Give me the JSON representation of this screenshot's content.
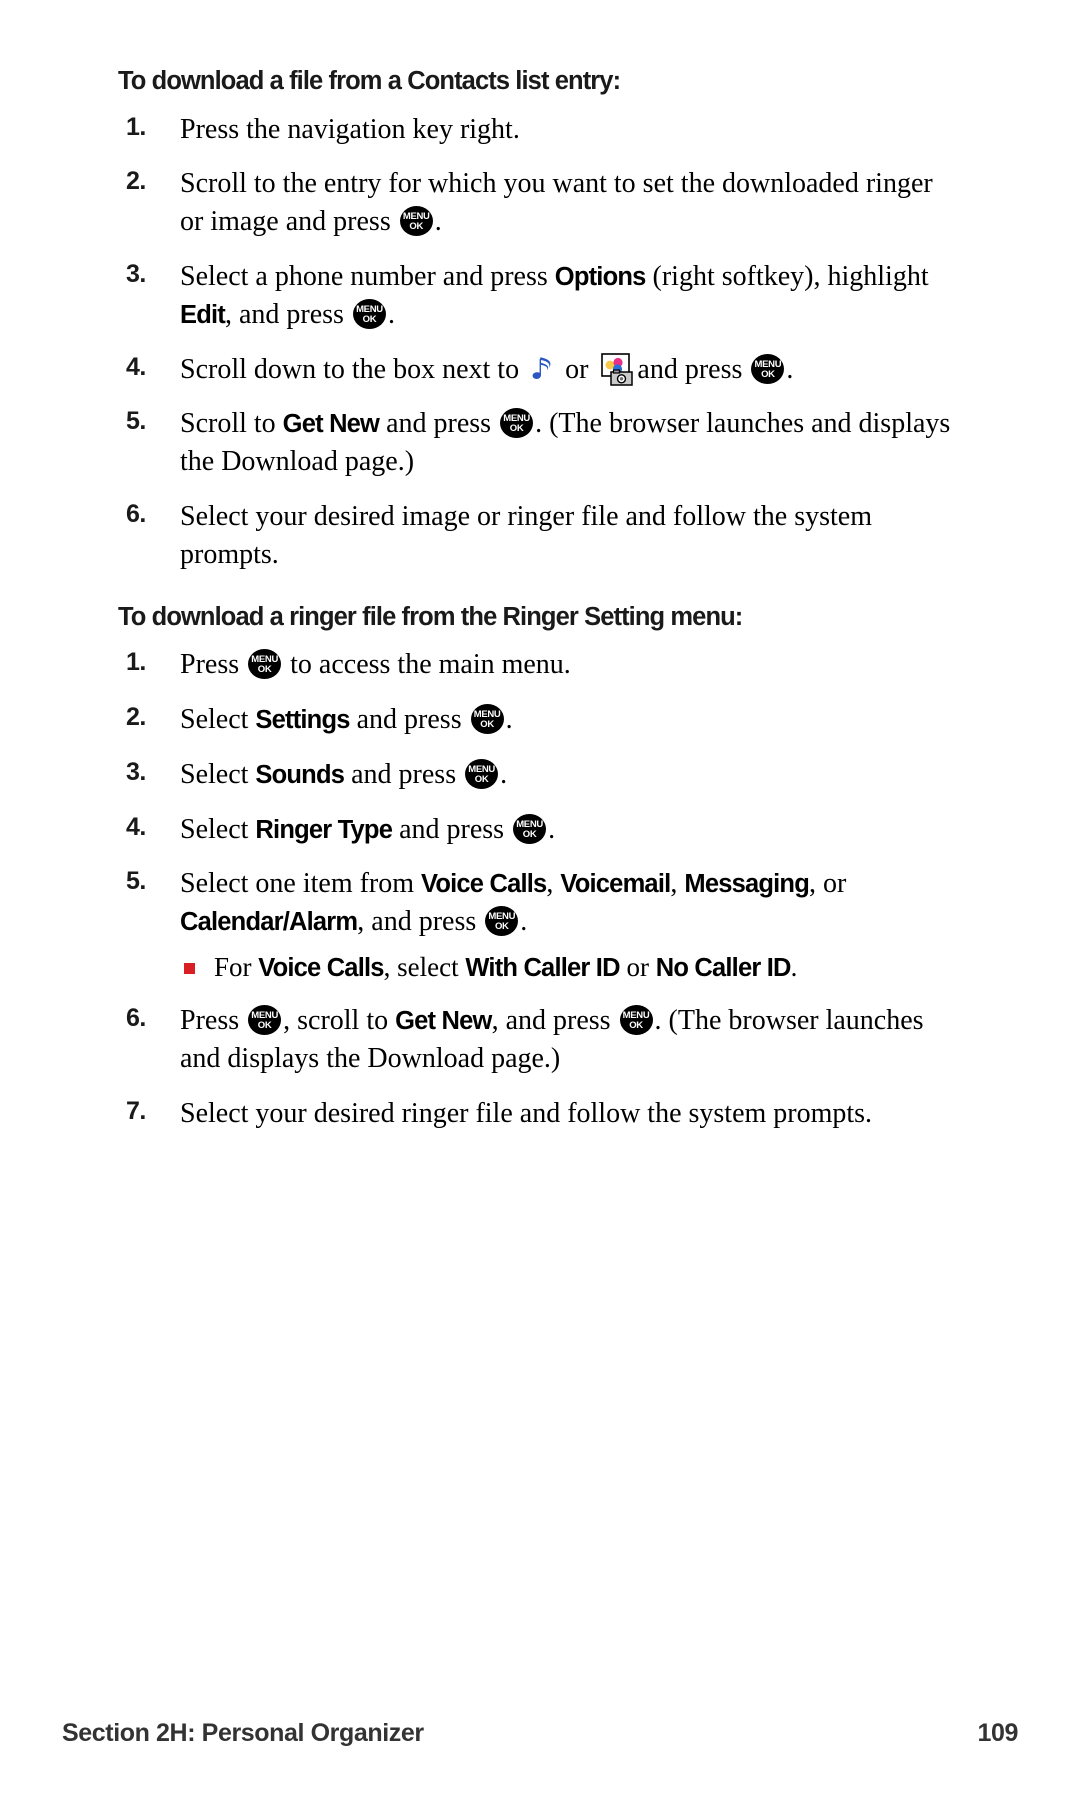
{
  "page": {
    "section_1": {
      "heading": "To download a file from a Contacts list entry:",
      "steps": [
        {
          "number": "1.",
          "parts": [
            {
              "t": "text",
              "v": "Press the navigation key right."
            }
          ]
        },
        {
          "number": "2.",
          "parts": [
            {
              "t": "text",
              "v": "Scroll to the entry for which you want to set the downloaded ringer or image and press "
            },
            {
              "t": "icon",
              "v": "menu-ok-key"
            },
            {
              "t": "text",
              "v": "."
            }
          ]
        },
        {
          "number": "3.",
          "parts": [
            {
              "t": "text",
              "v": "Select a phone number and press "
            },
            {
              "t": "bold",
              "v": "Options"
            },
            {
              "t": "text",
              "v": " (right softkey), highlight "
            },
            {
              "t": "bold",
              "v": "Edit"
            },
            {
              "t": "text",
              "v": ", and press "
            },
            {
              "t": "icon",
              "v": "menu-ok-key"
            },
            {
              "t": "text",
              "v": "."
            }
          ]
        },
        {
          "number": "4.",
          "parts": [
            {
              "t": "text",
              "v": "Scroll down to the box next to "
            },
            {
              "t": "icon",
              "v": "music-note-icon"
            },
            {
              "t": "text",
              "v": " or "
            },
            {
              "t": "icon",
              "v": "picture-icon"
            },
            {
              "t": "text",
              "v": "and press "
            },
            {
              "t": "icon",
              "v": "menu-ok-key"
            },
            {
              "t": "text",
              "v": "."
            }
          ]
        },
        {
          "number": "5.",
          "parts": [
            {
              "t": "text",
              "v": "Scroll to "
            },
            {
              "t": "bold",
              "v": "Get New"
            },
            {
              "t": "text",
              "v": " and press "
            },
            {
              "t": "icon",
              "v": "menu-ok-key"
            },
            {
              "t": "text",
              "v": ". (The browser launches and displays the Download page.)"
            }
          ]
        },
        {
          "number": "6.",
          "parts": [
            {
              "t": "text",
              "v": "Select your desired image or ringer file and follow the system prompts."
            }
          ]
        }
      ]
    },
    "section_2": {
      "heading": "To download a ringer file from the Ringer Setting menu:",
      "steps": [
        {
          "number": "1.",
          "parts": [
            {
              "t": "text",
              "v": "Press "
            },
            {
              "t": "icon",
              "v": "menu-ok-key"
            },
            {
              "t": "text",
              "v": " to access the main menu."
            }
          ]
        },
        {
          "number": "2.",
          "parts": [
            {
              "t": "text",
              "v": "Select "
            },
            {
              "t": "bold",
              "v": "Settings"
            },
            {
              "t": "text",
              "v": " and press "
            },
            {
              "t": "icon",
              "v": "menu-ok-key"
            },
            {
              "t": "text",
              "v": "."
            }
          ]
        },
        {
          "number": "3.",
          "parts": [
            {
              "t": "text",
              "v": "Select "
            },
            {
              "t": "bold",
              "v": "Sounds"
            },
            {
              "t": "text",
              "v": " and press "
            },
            {
              "t": "icon",
              "v": "menu-ok-key"
            },
            {
              "t": "text",
              "v": "."
            }
          ]
        },
        {
          "number": "4.",
          "parts": [
            {
              "t": "text",
              "v": "Select "
            },
            {
              "t": "bold",
              "v": "Ringer Type"
            },
            {
              "t": "text",
              "v": " and press "
            },
            {
              "t": "icon",
              "v": "menu-ok-key"
            },
            {
              "t": "text",
              "v": "."
            }
          ]
        },
        {
          "number": "5.",
          "parts": [
            {
              "t": "text",
              "v": "Select one item from "
            },
            {
              "t": "bold",
              "v": "Voice Calls"
            },
            {
              "t": "text",
              "v": ", "
            },
            {
              "t": "bold",
              "v": "Voicemail"
            },
            {
              "t": "text",
              "v": ", "
            },
            {
              "t": "bold",
              "v": "Messaging"
            },
            {
              "t": "text",
              "v": ", or "
            },
            {
              "t": "bold",
              "v": "Calendar/Alarm"
            },
            {
              "t": "text",
              "v": ", and press "
            },
            {
              "t": "icon",
              "v": "menu-ok-key"
            },
            {
              "t": "text",
              "v": "."
            }
          ],
          "sub": [
            {
              "parts": [
                {
                  "t": "text",
                  "v": "For "
                },
                {
                  "t": "bold",
                  "v": "Voice Calls"
                },
                {
                  "t": "text",
                  "v": ", select "
                },
                {
                  "t": "bold",
                  "v": "With Caller ID"
                },
                {
                  "t": "text",
                  "v": " or "
                },
                {
                  "t": "bold",
                  "v": "No Caller ID"
                },
                {
                  "t": "text",
                  "v": "."
                }
              ]
            }
          ]
        },
        {
          "number": "6.",
          "parts": [
            {
              "t": "text",
              "v": "Press "
            },
            {
              "t": "icon",
              "v": "menu-ok-key"
            },
            {
              "t": "text",
              "v": ", scroll to "
            },
            {
              "t": "bold",
              "v": "Get New"
            },
            {
              "t": "text",
              "v": ", and press "
            },
            {
              "t": "icon",
              "v": "menu-ok-key"
            },
            {
              "t": "text",
              "v": ". (The browser launches and displays the Download page.)"
            }
          ]
        },
        {
          "number": "7.",
          "parts": [
            {
              "t": "text",
              "v": "Select your desired ringer file and follow the system prompts."
            }
          ]
        }
      ]
    },
    "footer": {
      "section_label": "Section 2H: Personal Organizer",
      "page_number": "109"
    },
    "icons": {
      "menu_ok": {
        "line1": "MENU",
        "line2": "OK"
      }
    },
    "colors": {
      "bullet_red": "#d81f24",
      "note_blue": "#2b56c4",
      "text_black": "#000000",
      "heading_gray": "#1a1a1a",
      "footer_gray": "#333333"
    }
  }
}
